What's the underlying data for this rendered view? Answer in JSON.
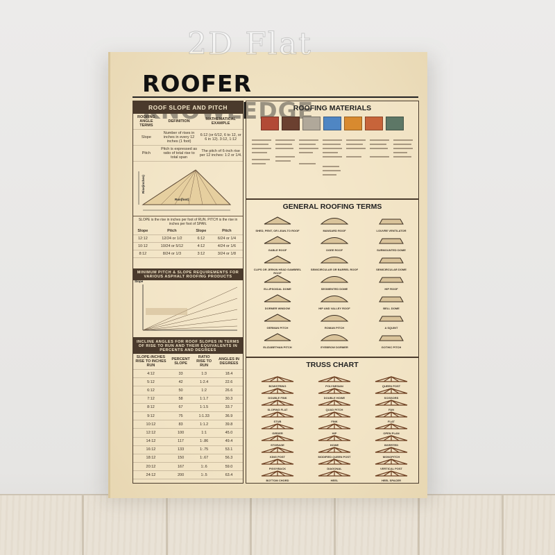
{
  "watermark": "2D Flat",
  "title": "ROOFER KNOWLEDGE",
  "slope_panel": {
    "heading": "ROOF SLOPE AND PITCH",
    "headers": [
      "ROOFING ANGLE TERMS",
      "DEFINITION",
      "MATHEMATICAL EXAMPLE"
    ],
    "rows": [
      [
        "Slope",
        "Number of rises in inches in every 12 inches (1 foot)",
        "6:12 (or 6/12, 6 to 12, or 6 in 12). 3:12, 1:12"
      ],
      [
        "Pitch",
        "Pitch is expressed as ratio of total rise to total span",
        "The pitch of 6-inch rise per 12 inches: 1:2 or 1/4."
      ]
    ],
    "diagram_run": "Run(foot)",
    "diagram_rise": "Rise(inches)",
    "note": "SLOPE is the rise in inches per foot of RUN. PITCH is the rise in inches per foot of SPAN.",
    "pairs_headers": [
      "Slope",
      "Pitch",
      "Slope",
      "Pitch"
    ],
    "pairs": [
      [
        "12:12",
        "12/24 or 1/2",
        "6:12",
        "6/24 or 1/4"
      ],
      [
        "10:12",
        "10/24 or 5/12",
        "4:12",
        "4/24 or 1/6"
      ],
      [
        "8:12",
        "8/24 or 1/3",
        "3:12",
        "3/24 or 1/8"
      ]
    ]
  },
  "min_pitch": {
    "heading": "MINIMUM PITCH & SLOPE REQUIREMENTS FOR VARIOUS ASPHALT ROOFING PRODUCTS",
    "axis": "Slope"
  },
  "incline": {
    "heading": "INCLINE ANGLES FOR ROOF SLOPES IN TERMS OF RISE TO RUN AND THEIR EQUIVALENTS IN PERCENTS AND DEGREES",
    "headers": [
      "SLOPE-INCHES RISE TO INCHES RUN",
      "PERCENT SLOPE",
      "RATIO RISE TO RUN",
      "ANGLES IN DEGREES"
    ],
    "rows": [
      [
        "4:12",
        "33",
        "1:3",
        "18.4"
      ],
      [
        "5:12",
        "42",
        "1:2.4",
        "22.6"
      ],
      [
        "6:12",
        "50",
        "1:2",
        "26.6"
      ],
      [
        "7:12",
        "58",
        "1:1.7",
        "30.3"
      ],
      [
        "8:12",
        "67",
        "1:1.5",
        "33.7"
      ],
      [
        "9:12",
        "75",
        "1:1.33",
        "36.9"
      ],
      [
        "10:12",
        "83",
        "1:1.2",
        "39.8"
      ],
      [
        "12:12",
        "100",
        "1:1",
        "45.0"
      ],
      [
        "14:12",
        "117",
        "1:.86",
        "49.4"
      ],
      [
        "16:12",
        "133",
        "1:.75",
        "53.1"
      ],
      [
        "18:12",
        "150",
        "1:.67",
        "56.3"
      ],
      [
        "20:12",
        "167",
        "1:.6",
        "59.0"
      ],
      [
        "24:12",
        "200",
        "1:.5",
        "63.4"
      ]
    ]
  },
  "materials": {
    "heading": "ROOFING MATERIALS",
    "colors": [
      "#b24a36",
      "#6b4030",
      "#b0a89a",
      "#4f86c3",
      "#d88a2f",
      "#c7643a",
      "#5d7766"
    ]
  },
  "terms": {
    "heading": "GENERAL ROOFING TERMS",
    "labels": [
      "SHED, PENT, OR LEAN-TO ROOF",
      "MANSARD ROOF",
      "LOUVRE VENTILATOR",
      "GABLE ROOF",
      "OGEE ROOF",
      "SURMOUNTED DOME",
      "CLIPS OR JERKIN HEAD GAMBREL ROOF",
      "SEMICIRCULAR OR BARREL ROOF",
      "SEMICIRCULAR DOME",
      "ELLIPSOIDAL DOME",
      "SEGMENTED DOME",
      "HIP ROOF",
      "DORMER WINDOW",
      "HIP AND VALLEY ROOF",
      "BELL DOME",
      "GERMAN PITCH",
      "ROMAN PITCH",
      "A SQUINT",
      "ELIZABETHAN PITCH",
      "EYEBROW DORMER",
      "GOTHIC PITCH"
    ]
  },
  "truss": {
    "heading": "TRUSS CHART",
    "labels": [
      "BOWSTRING",
      "POLYNESIAN",
      "QUEEN POST",
      "DOUBLE FINK",
      "DOUBLE HOWE",
      "SCISSORS",
      "SLOPING FLAT",
      "QUAD PITCH",
      "FAN",
      "STUB",
      "FINK",
      "FLAT",
      "GIRDER",
      "HIP",
      "OPEN PLAN",
      "STORAGE",
      "HOWE",
      "INVERTED",
      "KING POST",
      "MODIFIED QUEEN POST",
      "MONOPITCH",
      "PIGGYBACK",
      "DIAGONAL",
      "VERTICAL POST",
      "BOTTOM CHORD",
      "HEEL",
      "HEEL SPACER"
    ]
  }
}
